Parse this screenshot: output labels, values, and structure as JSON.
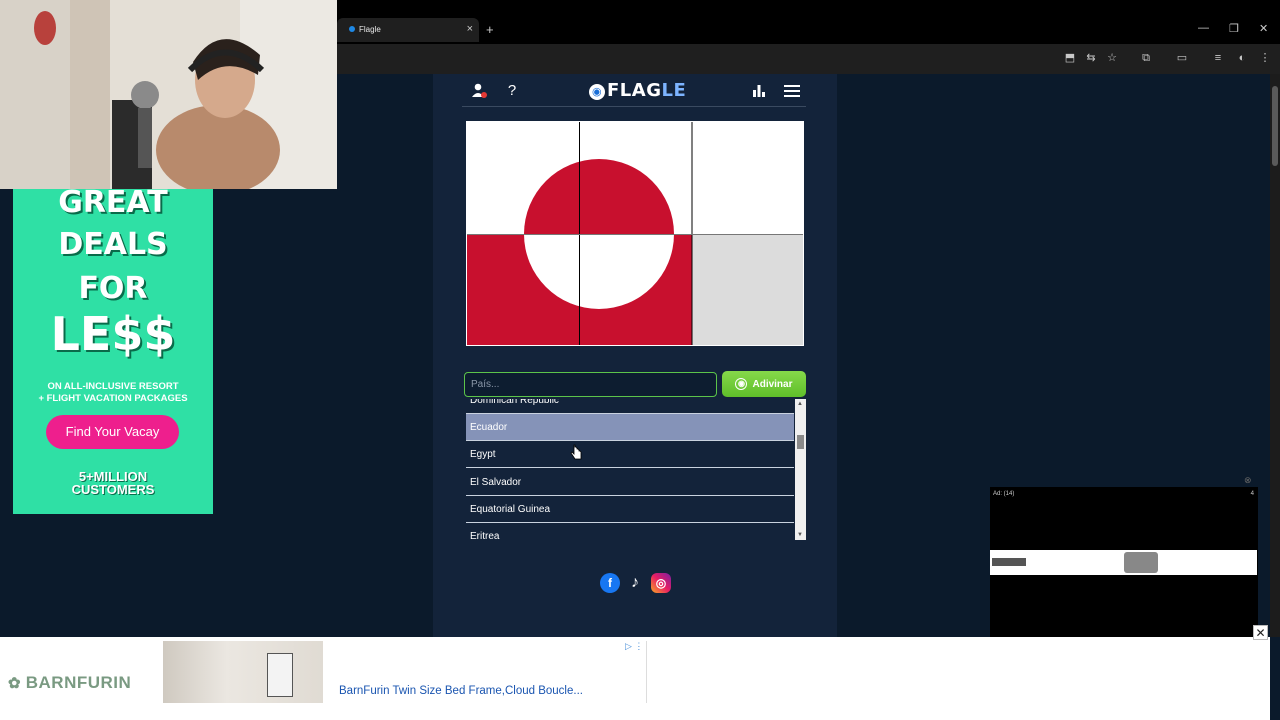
{
  "browser": {
    "tab_title": "Flagle",
    "tab_close": "×",
    "new_tab": "+",
    "minimize": "—",
    "restore": "❐",
    "close": "✕"
  },
  "header": {
    "logo_prefix": "FLAG",
    "logo_suffix": "LE",
    "help": "?"
  },
  "search": {
    "placeholder": "País...",
    "button_label": "Adivinar"
  },
  "dropdown": {
    "options": [
      "Dominican Republic",
      "Ecuador",
      "Egypt",
      "El Salvador",
      "Equatorial Guinea",
      "Eritrea"
    ],
    "selected": "Ecuador"
  },
  "flag_colors": {
    "red": "#c8102e",
    "white": "#ffffff",
    "hidden": "#dcdcdc"
  },
  "left_ad": {
    "line1": "GREAT",
    "line2": "DEALS",
    "line3": "FOR",
    "line4": "LE$$",
    "sub1": "ON ALL-INCLUSIVE RESORT",
    "sub2": "+ FLIGHT VACATION PACKAGES",
    "cta": "Find Your Vacay",
    "stat1": "5+MILLION",
    "stat2": "CUSTOMERS"
  },
  "right_ad": {
    "label": "Ad: (14)",
    "count": "4"
  },
  "bottom_ad": {
    "brand": "BARNFURIN",
    "title": "BarnFurin Twin Size Bed Frame,Cloud Boucle..."
  },
  "colors": {
    "accent_green": "#5fbf2a",
    "page_bg": "#0b1a2b",
    "panel_bg": "#13233a",
    "selected_row": "#8593b8"
  }
}
